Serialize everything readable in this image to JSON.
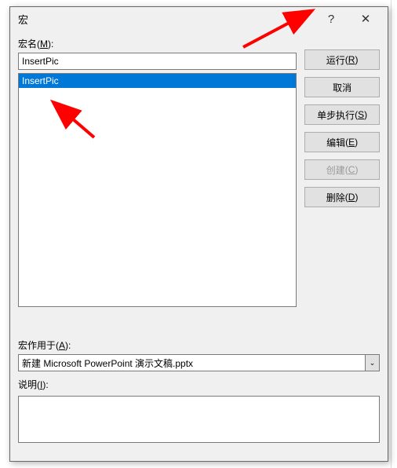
{
  "titlebar": {
    "title": "宏",
    "help": "?",
    "close": "✕"
  },
  "labels": {
    "macro_name": "宏名(",
    "macro_name_key": "M",
    "macro_name_end": "):",
    "macro_in": "宏作用于(",
    "macro_in_key": "A",
    "macro_in_end": "):",
    "description": "说明(",
    "description_key": "I",
    "description_end": "):"
  },
  "input": {
    "macro_name_value": "InsertPic"
  },
  "list": {
    "items": [
      "InsertPic"
    ],
    "selected": 0
  },
  "buttons": {
    "run": "运行",
    "run_key": "R",
    "cancel": "取消",
    "step": "单步执行",
    "step_key": "S",
    "edit": "编辑",
    "edit_key": "E",
    "create": "创建",
    "create_key": "C",
    "delete": "删除",
    "delete_key": "D"
  },
  "macro_in_value": "新建 Microsoft PowerPoint 演示文稿.pptx",
  "chevron": "⌄"
}
